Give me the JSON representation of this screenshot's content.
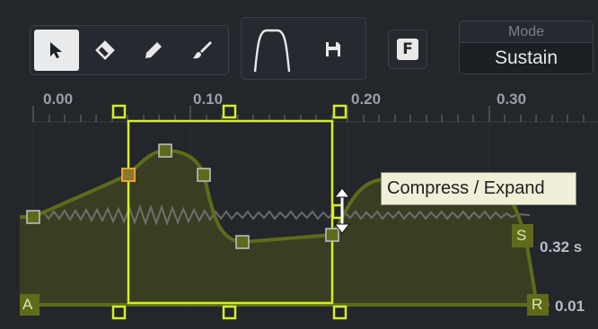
{
  "toolbar": {
    "tools": [
      {
        "name": "select",
        "icon": "arrow-pointer-icon",
        "active": true
      },
      {
        "name": "erase",
        "icon": "eraser-icon",
        "active": false
      },
      {
        "name": "draw",
        "icon": "pencil-icon",
        "active": false
      },
      {
        "name": "paint",
        "icon": "brush-icon",
        "active": false
      }
    ],
    "curve_preset_icon": "envelope-curve-icon",
    "save_icon": "save-icon",
    "f_button_label": "F",
    "mode": {
      "title": "Mode",
      "value": "Sustain"
    }
  },
  "ruler": {
    "labels": [
      "0.00",
      "0.10",
      "0.20",
      "0.30"
    ]
  },
  "envelope": {
    "sustain_marker": "S",
    "release_marker": "R",
    "attack_marker": "A",
    "sustain_value": "0.32 s",
    "release_value": "0.01",
    "tooltip": "Compress / Expand"
  },
  "colors": {
    "background": "#23262b",
    "envelope_line": "#5f6b1a",
    "envelope_fill": "#3a3f22",
    "selection": "#d6ef25",
    "highlight_node": "#e8a13a"
  }
}
